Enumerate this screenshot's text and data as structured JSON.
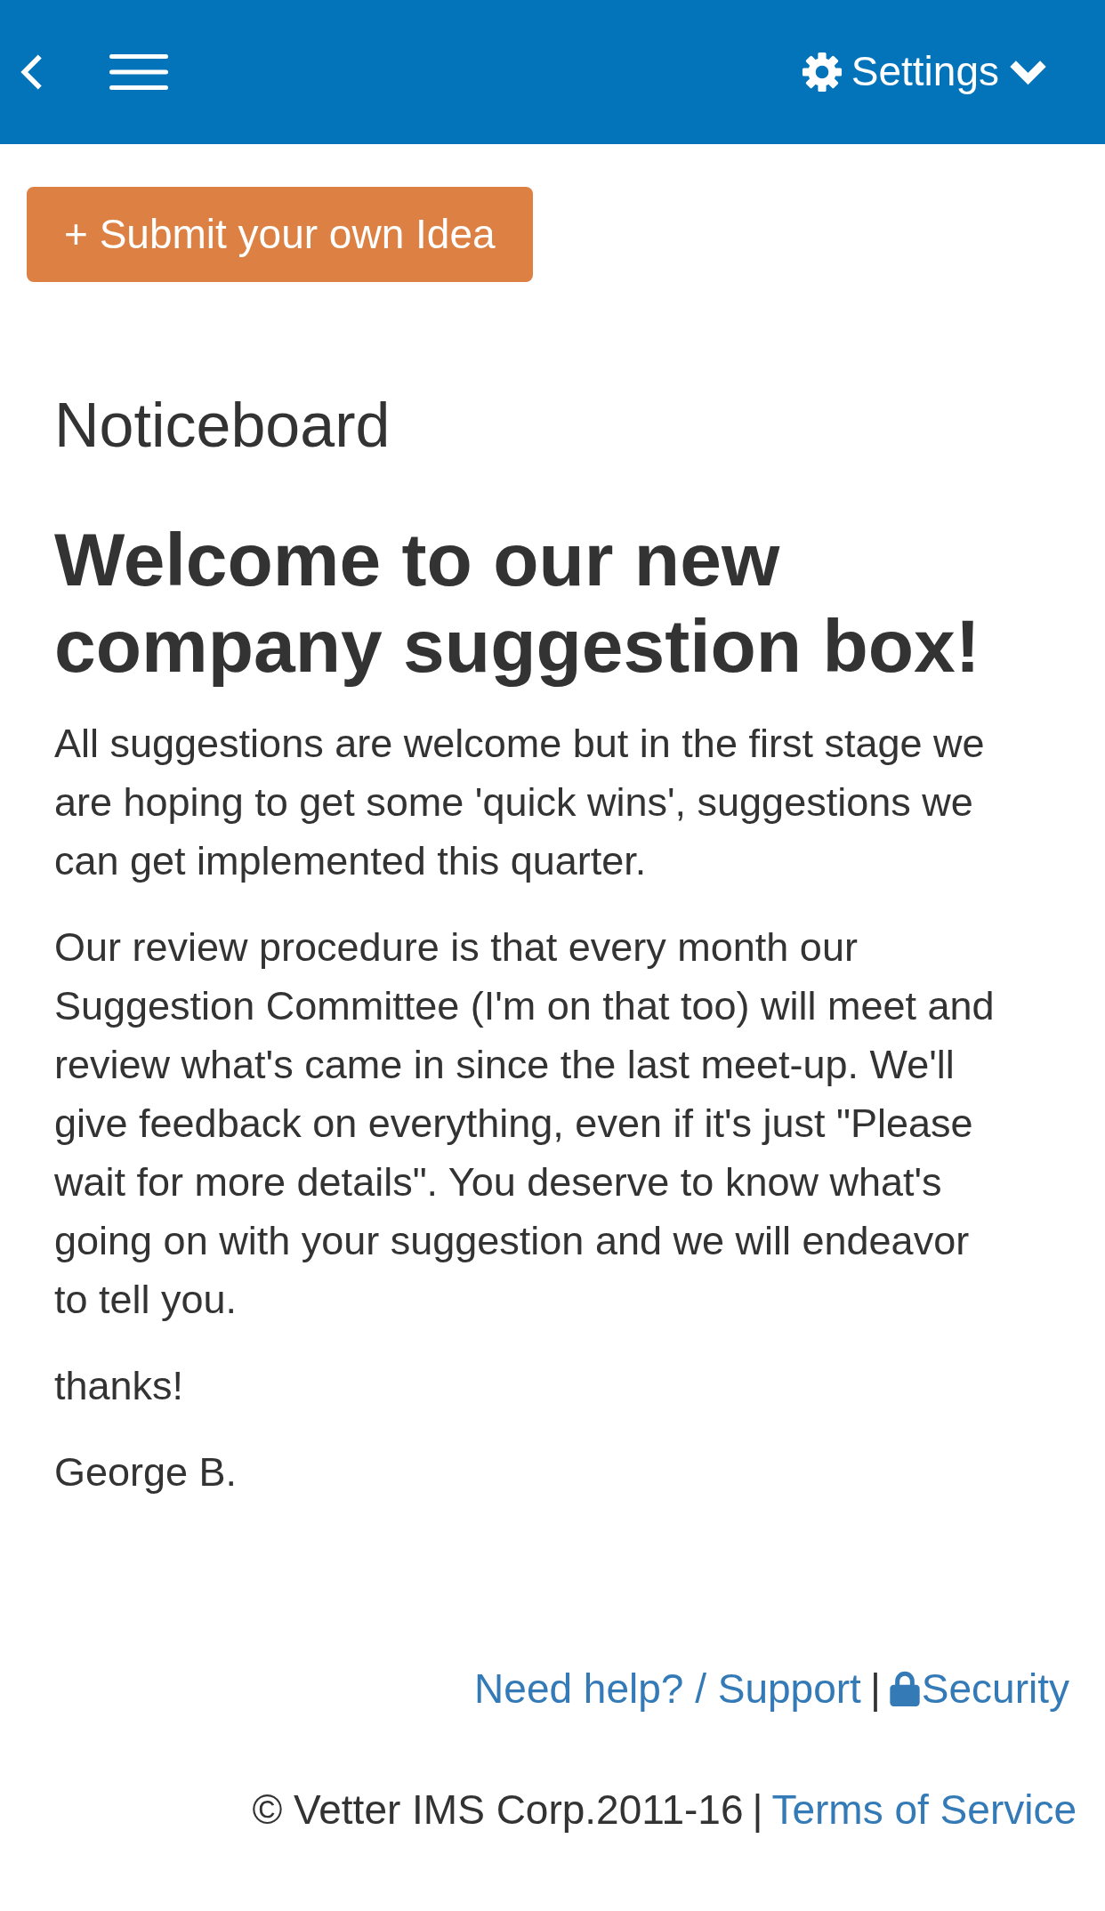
{
  "header": {
    "settings_label": "Settings"
  },
  "submit_button": "+ Submit your own Idea",
  "noticeboard": {
    "title": "Noticeboard",
    "heading": "Welcome to our new company suggestion box!",
    "paragraphs": [
      "All suggestions are welcome but in the first stage we are hoping to get some 'quick wins', suggestions we can get implemented this quarter.",
      "Our review procedure is that every month our Suggestion Committee (I'm on that too) will meet and review what's came in since the last meet-up. We'll give feedback on everything, even if it's just \"Please wait for more details\". You deserve to know what's going on with your suggestion and we will endeavor to tell you.",
      "thanks!",
      "George B."
    ]
  },
  "footer": {
    "support_link": "Need help? / Support",
    "separator_1": "|",
    "security_link": "Security",
    "copyright": "© Vetter IMS Corp.2011-16",
    "separator_2": "|",
    "terms_link": "Terms of Service"
  }
}
